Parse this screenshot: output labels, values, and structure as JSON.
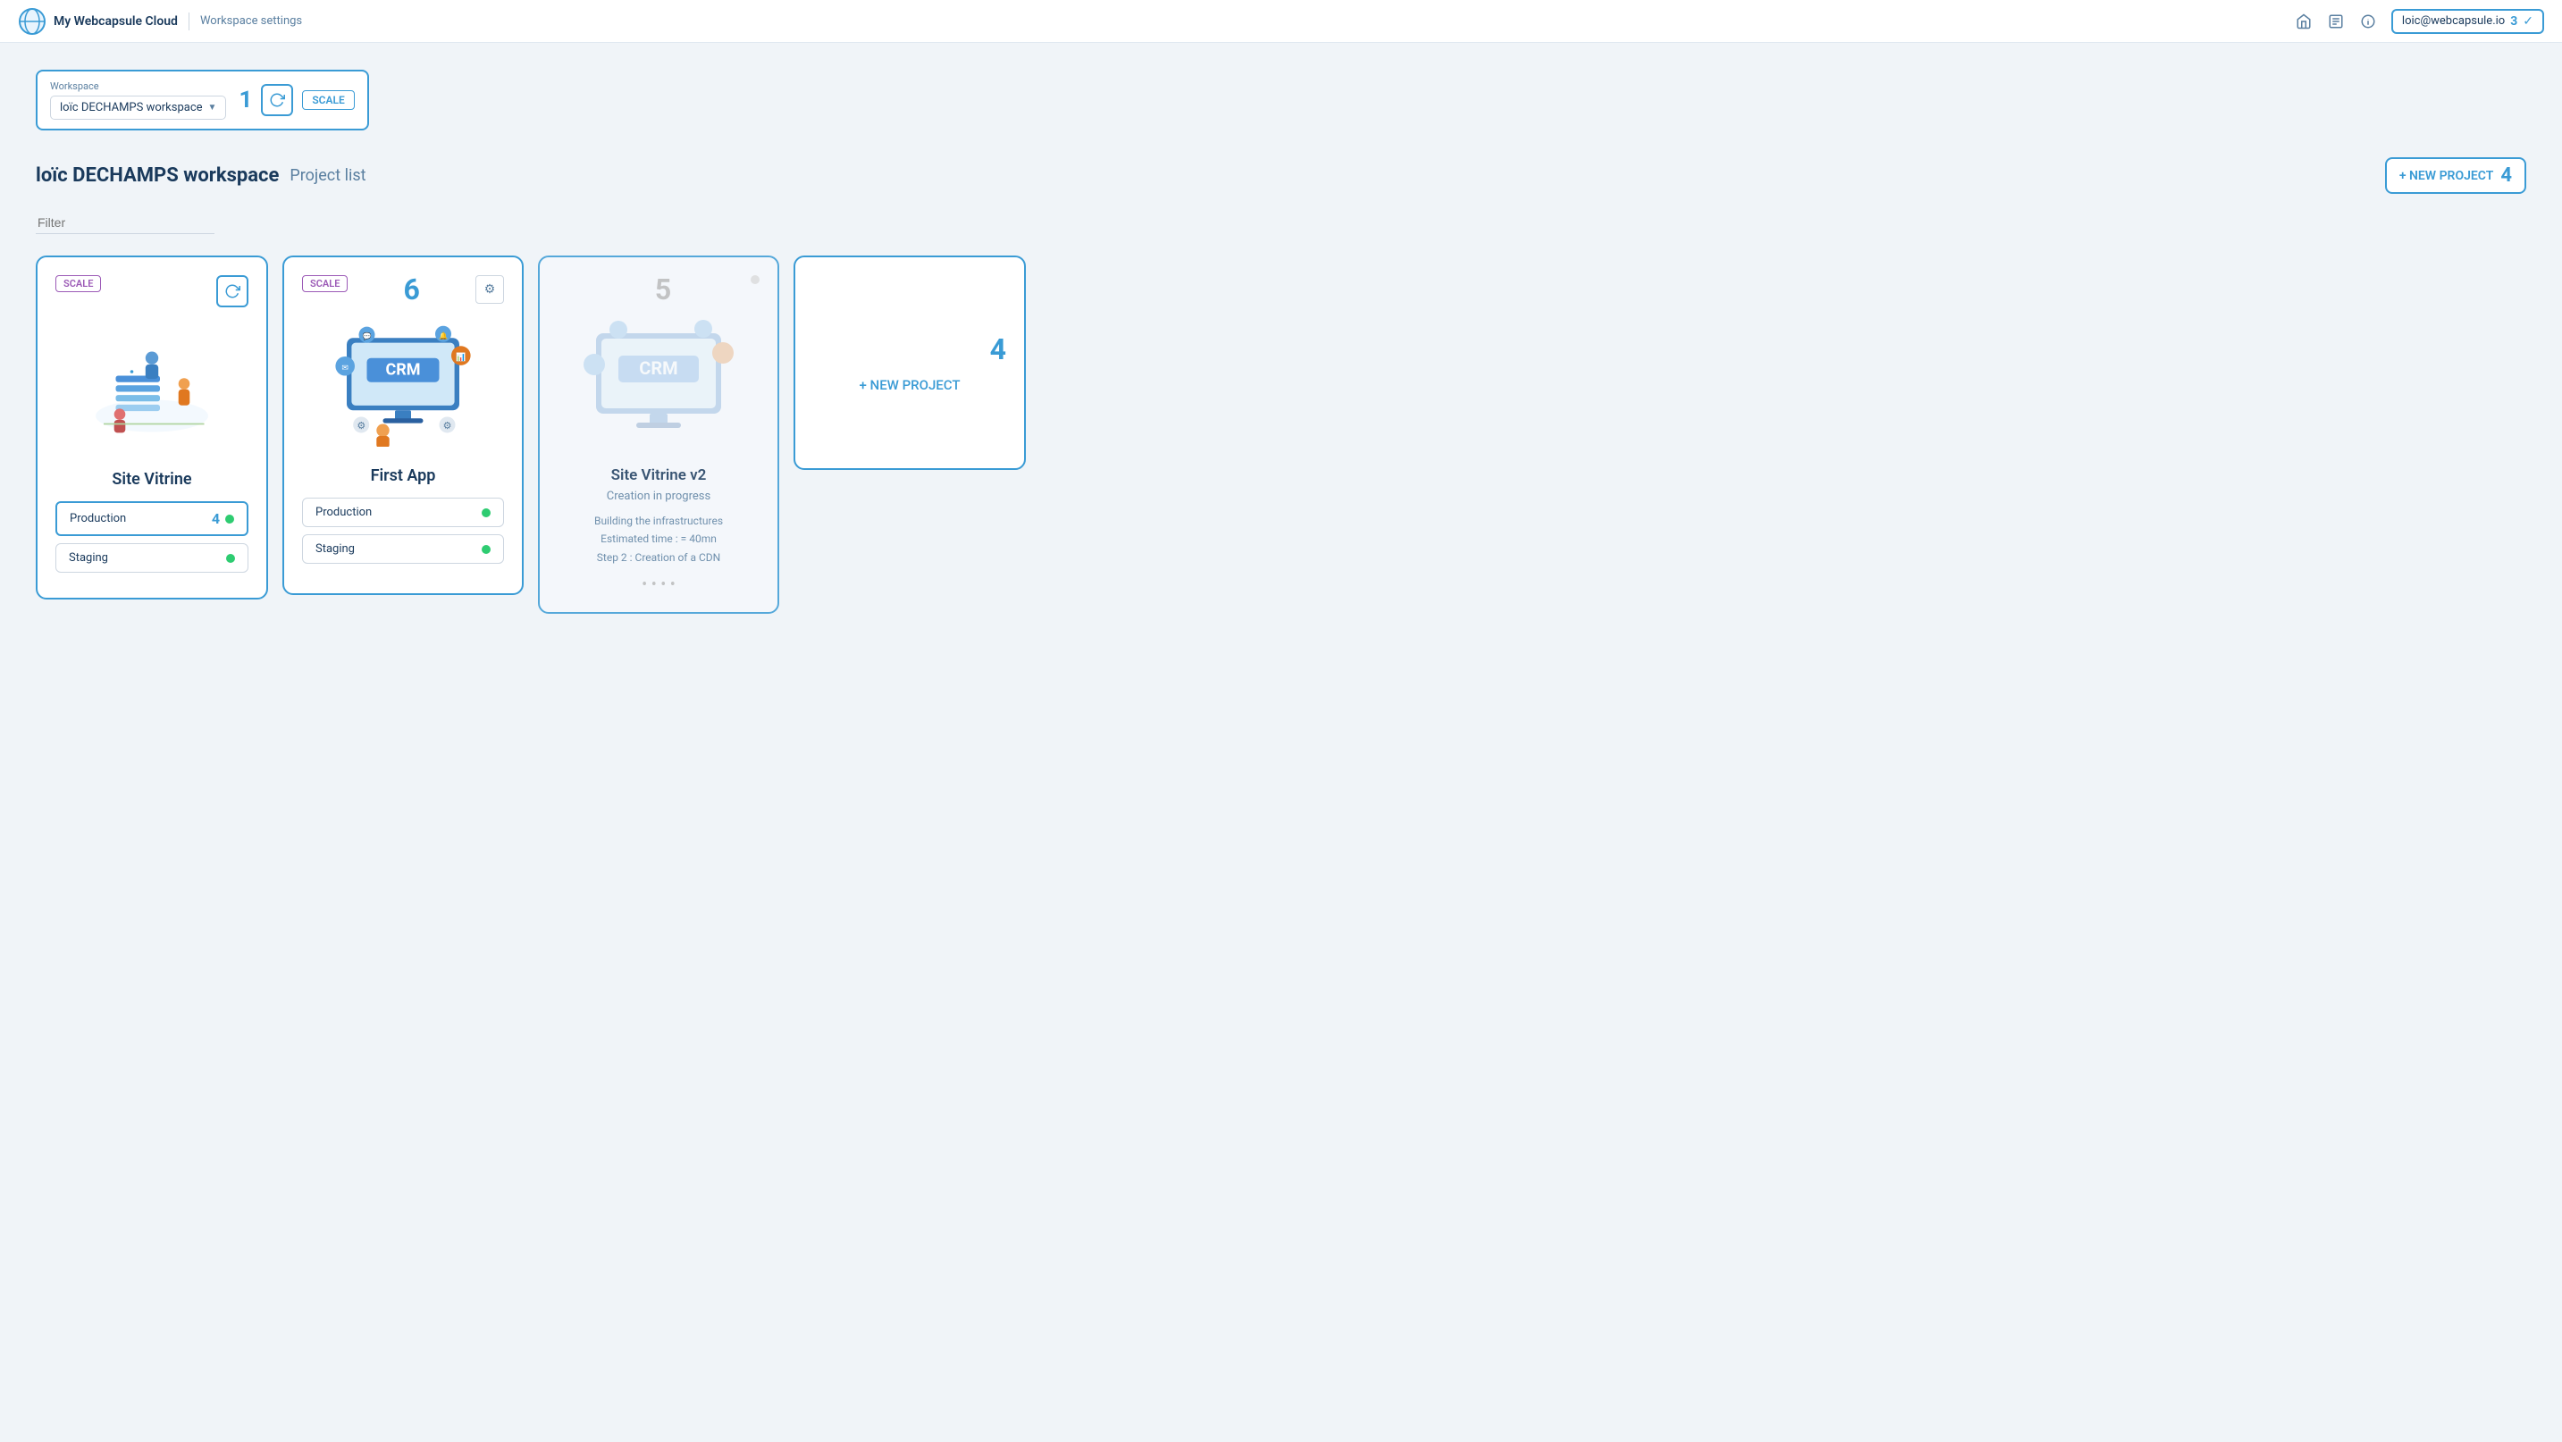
{
  "header": {
    "logo_text": "My Webcapsule Cloud",
    "settings_link": "Workspace settings",
    "user_email": "loic@webcapsule.io",
    "user_num": "3",
    "home_icon": "🏠",
    "doc_icon": "☰",
    "info_icon": "ℹ"
  },
  "workspace_selector": {
    "label": "Workspace",
    "selected": "loïc DECHAMPS workspace",
    "num": "1",
    "scale_label": "SCALE",
    "refresh_icon": "↻"
  },
  "page": {
    "workspace_name": "loïc DECHAMPS workspace",
    "project_list_label": "Project list",
    "filter_placeholder": "Filter",
    "new_project_button": "+ NEW PROJECT",
    "new_project_num": "4"
  },
  "cards": [
    {
      "id": "site-vitrine",
      "scale_badge": "SCALE",
      "num": "",
      "title": "Site Vitrine",
      "has_illustration": true,
      "illustration_type": "site-vitrine",
      "environments": [
        {
          "name": "Production",
          "status": "online",
          "num": "4",
          "highlighted": true
        },
        {
          "name": "Staging",
          "status": "online",
          "num": "",
          "highlighted": false
        }
      ],
      "highlighted": true
    },
    {
      "id": "first-app",
      "scale_badge": "SCALE",
      "num": "6",
      "title": "First App",
      "has_illustration": true,
      "illustration_type": "crm",
      "settings_icon": "⚙",
      "environments": [
        {
          "name": "Production",
          "status": "online",
          "num": "",
          "highlighted": false
        },
        {
          "name": "Staging",
          "status": "online",
          "num": "",
          "highlighted": false
        }
      ],
      "highlighted": true
    },
    {
      "id": "site-vitrine-v2",
      "scale_badge": "",
      "num": "5",
      "title": "Site Vitrine v2",
      "in_progress": true,
      "creation_label": "Creation in progress",
      "info_lines": [
        "Building the infrastructures",
        "Estimated time : = 40mn",
        "Step 2 : Creation of a CDN"
      ],
      "highlighted": true
    },
    {
      "id": "new-project",
      "type": "new",
      "num": "4",
      "label": "+ NEW PROJECT",
      "highlighted": true
    }
  ]
}
